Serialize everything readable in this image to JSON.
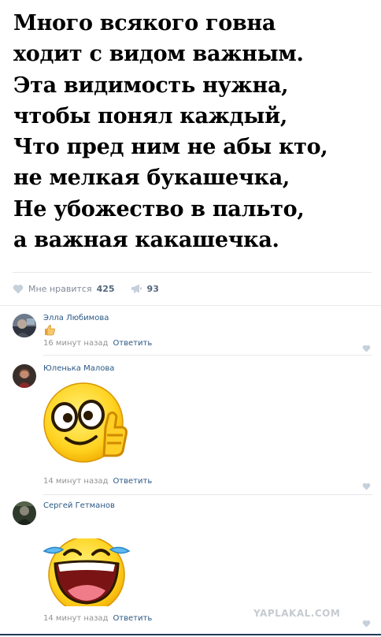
{
  "post": {
    "poem_lines": [
      "Много всякого говна",
      "ходит с видом важным.",
      "Эта видимость нужна,",
      "чтобы понял каждый,",
      "Что пред ним не абы кто,",
      "не мелкая букашечка,",
      "Не убожество в пальто,",
      "а важная какашечка."
    ],
    "like_label": "Мне нравится",
    "like_count": "425",
    "share_count": "93"
  },
  "comments": [
    {
      "author": "Элла Любимова",
      "time": "16 минут назад",
      "reply": "Ответить",
      "content": "thumbs-up-emoji"
    },
    {
      "author": "Юленька Малова",
      "time": "14 минут назад",
      "reply": "Ответить",
      "content": "thumbs-up-smiley-sticker"
    },
    {
      "author": "Сергей Гетманов",
      "time": "14 минут назад",
      "reply": "Ответить",
      "content": "tears-of-joy-sticker"
    }
  ],
  "watermark": "YAPLAKAL.COM",
  "colors": {
    "link": "#2a5885",
    "meta": "#939393",
    "separator": "#e7e8ec"
  }
}
